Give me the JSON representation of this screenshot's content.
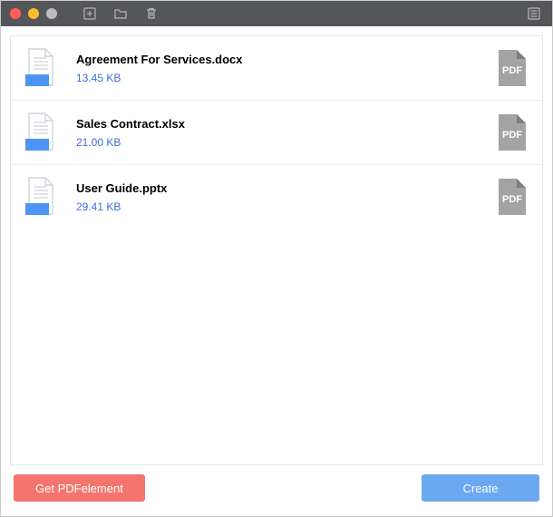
{
  "titlebar": {
    "buttons": [
      "add-file-icon",
      "open-folder-icon",
      "trash-icon",
      "settings-panel-icon"
    ]
  },
  "files": [
    {
      "name": "Agreement For Services.docx",
      "size": "13.45 KB"
    },
    {
      "name": "Sales Contract.xlsx",
      "size": "21.00 KB"
    },
    {
      "name": "User Guide.pptx",
      "size": "29.41 KB"
    }
  ],
  "footer": {
    "get_label": "Get PDFelement",
    "create_label": "Create"
  },
  "colors": {
    "accent_red": "#f4756d",
    "accent_blue": "#6ca8f1",
    "link_blue": "#3f6fd8"
  }
}
